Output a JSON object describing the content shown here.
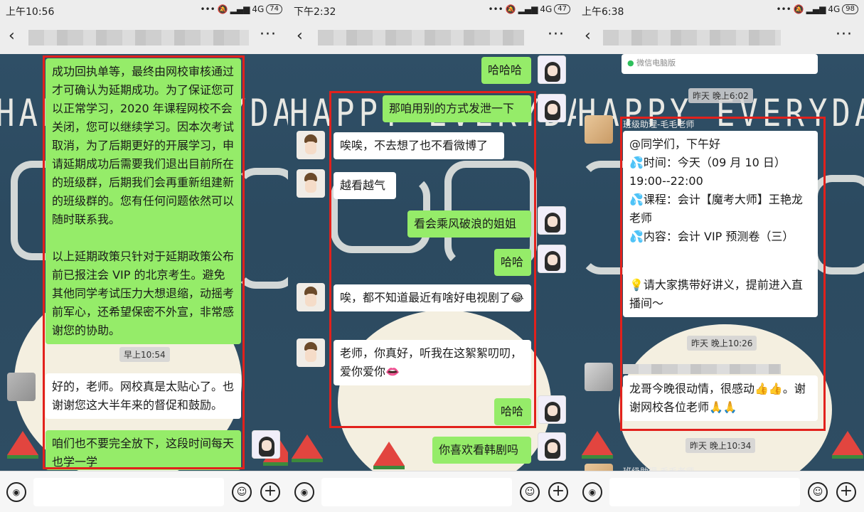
{
  "panels": [
    {
      "status_time": "上午10:56",
      "battery": "74",
      "network": "4G",
      "messages": {
        "m1": "成功回执单等，最终由网校审核通过才可确认为延期成功。为了保证您可以正常学习，2020 年课程网校不会关闭，您可以继续学习。因本次考试取消，为了后期更好的开展学习，申请延期成功后需要我们退出目前所在的班级群，后期我们会再重新组建新的班级群的。您有任何问题依然可以随时联系我。",
        "m1b": "以上延期政策只针对于延期政策公布前已报注会 VIP 的北京考生。避免其他同学考试压力大想退缩，动摇考前军心，还希望保密不外宣，非常感谢您的协助。",
        "ts1": "早上10:54",
        "m2": "好的，老师。网校真是太贴心了。也谢谢您这大半年来的督促和鼓励。",
        "m3": "咱们也不要完全放下，这段时间每天也学一学"
      }
    },
    {
      "status_time": "下午2:32",
      "battery": "47",
      "network": "4G",
      "messages": {
        "m1": "哈哈哈",
        "m2": "那咱用别的方式发泄一下",
        "m3": "唉唉，不去想了也不看微博了",
        "m4": "越看越气",
        "m5": "看会乘风破浪的姐姐",
        "m6": "哈哈",
        "m7": "唉，都不知道最近有啥好电视剧了😂",
        "m8": "老师，你真好，听我在这絮絮叨叨，爱你爱你👄",
        "m9": "哈哈",
        "m10": "你喜欢看韩剧吗"
      }
    },
    {
      "status_time": "上午6:38",
      "battery": "98",
      "network": "4G",
      "card_text": "微信电脑版",
      "ts1": "昨天 晚上6:02",
      "sender": "班级助理-毛毛老师",
      "messages": {
        "line1": "@同学们，下午好",
        "line2": "💦时间：今天（09 月 10 日）19:00--22:00",
        "line3": "💦课程：会计【魔考大师】王艳龙老师",
        "line4": "💦内容：会计 VIP 预测卷（三）",
        "line5": "💡请大家携带好讲义，提前进入直播间～",
        "ts2": "昨天 晚上10:26",
        "m2": "龙哥今晚很动情，很感动👍👍。谢谢网校各位老师🙏🙏",
        "ts3": "昨天 晚上10:34",
        "sender2": "班级助理-毛毛老师"
      }
    }
  ],
  "wallpaper_text": "HAPPY EVERYDAY",
  "icons": {
    "back": "‹",
    "more": "···",
    "voice": "voice-icon",
    "emoji": "emoji-icon",
    "plus": "plus-icon"
  },
  "colors": {
    "sent_bubble": "#95ec69",
    "recv_bubble": "#ffffff",
    "highlight_box": "#e2211c",
    "wallpaper": "#2f4f66"
  }
}
